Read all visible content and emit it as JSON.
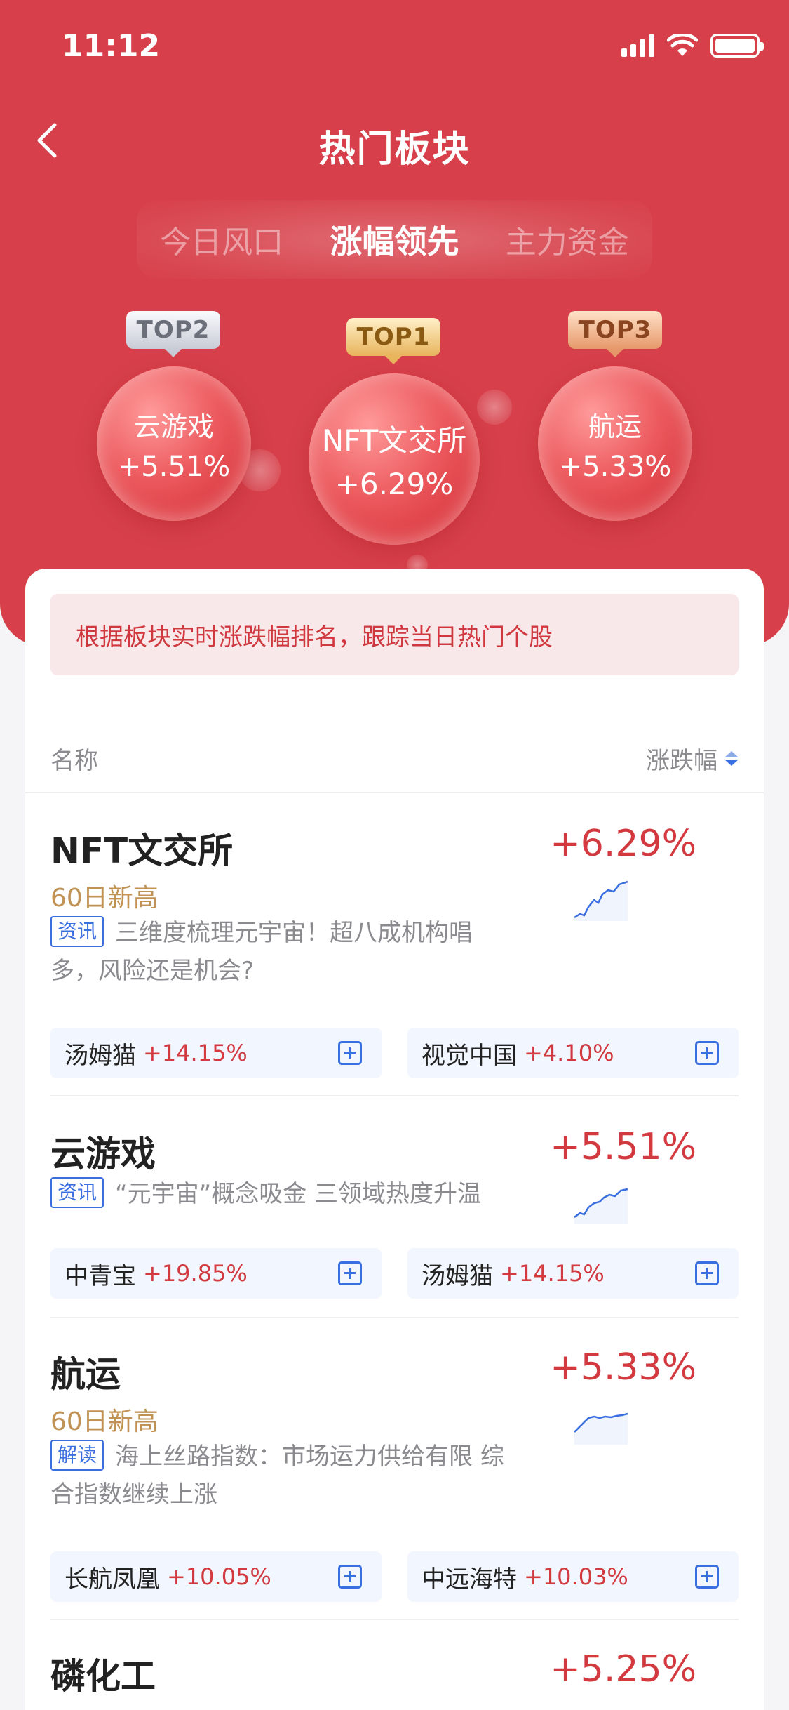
{
  "status_bar": {
    "time": "11:12"
  },
  "nav": {
    "title": "热门板块"
  },
  "tabs": [
    {
      "label": "今日风口",
      "active": false
    },
    {
      "label": "涨幅领先",
      "active": true
    },
    {
      "label": "主力资金",
      "active": false
    }
  ],
  "top_sectors": [
    {
      "rank": "TOP2",
      "name": "云游戏",
      "pct": "+5.51%"
    },
    {
      "rank": "TOP1",
      "name": "NFT文交所",
      "pct": "+6.29%"
    },
    {
      "rank": "TOP3",
      "name": "航运",
      "pct": "+5.33%"
    }
  ],
  "notice": "根据板块实时涨跌幅排名，跟踪当日热门个股",
  "list_header": {
    "name": "名称",
    "change": "涨跌幅"
  },
  "sectors": [
    {
      "name": "NFT文交所",
      "pct": "+6.29%",
      "tag": "60日新高",
      "news_tag": "资讯",
      "news": "三维度梳理元宇宙！超八成机构唱多，风险还是机会?",
      "stocks": [
        {
          "name": "汤姆猫",
          "pct": "+14.15%"
        },
        {
          "name": "视觉中国",
          "pct": "+4.10%"
        }
      ]
    },
    {
      "name": "云游戏",
      "pct": "+5.51%",
      "news_tag": "资讯",
      "news": "“元宇宙”概念吸金 三领域热度升温",
      "stocks": [
        {
          "name": "中青宝",
          "pct": "+19.85%"
        },
        {
          "name": "汤姆猫",
          "pct": "+14.15%"
        }
      ]
    },
    {
      "name": "航运",
      "pct": "+5.33%",
      "tag": "60日新高",
      "news_tag": "解读",
      "news": "海上丝路指数：市场运力供给有限 综合指数继续上涨",
      "stocks": [
        {
          "name": "长航凤凰",
          "pct": "+10.05%"
        },
        {
          "name": "中远海特",
          "pct": "+10.03%"
        }
      ]
    },
    {
      "name": "磷化工",
      "pct": "+5.25%"
    }
  ],
  "colors": {
    "brand_red": "#d7404a",
    "up_red": "#d23a40",
    "link_blue": "#3a6fe0",
    "tag_gold": "#c09254"
  }
}
